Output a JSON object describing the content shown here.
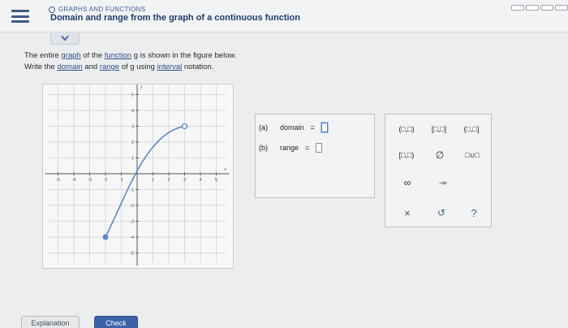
{
  "header": {
    "breadcrumb": "GRAPHS AND FUNCTIONS",
    "title": "Domain and range from the graph of a continuous function"
  },
  "prompt": {
    "line1_a": "The entire ",
    "line1_graph": "graph",
    "line1_b": " of the ",
    "line1_function": "function",
    "line1_c": " g is shown in the figure below.",
    "line2_a": "Write the ",
    "line2_domain": "domain",
    "line2_b": " and ",
    "line2_range": "range",
    "line2_c": " of g using ",
    "line2_interval": "interval",
    "line2_d": " notation."
  },
  "graph": {
    "y_axis_label": "y",
    "x_axis_label": "x",
    "x_tick_labels": [
      "-5",
      "-4",
      "-3",
      "-2",
      "-1",
      "1",
      "2",
      "3",
      "4",
      "5"
    ],
    "y_tick_labels": [
      "5",
      "4",
      "3",
      "2",
      "1",
      "-1",
      "-2",
      "-3",
      "-4",
      "-5"
    ],
    "curve_start": [
      -2,
      -4
    ],
    "curve_end": [
      3,
      3
    ],
    "start_point": "closed",
    "end_point": "open",
    "curve_color": "#5b86c9"
  },
  "answers": {
    "domain_label_prefix": "(a)",
    "domain_label": "domain",
    "range_label_prefix": "(b)",
    "range_label": "range",
    "equals": "="
  },
  "keypad": {
    "open_open": "(□,□)",
    "closed_closed": "[□,□]",
    "open_closed": "(□,□]",
    "closed_open": "[□,□)",
    "empty_set": "∅",
    "union": "□∪□",
    "infinity": "∞",
    "neg_infinity": "-∞",
    "clear": "×",
    "undo": "↺",
    "help": "?"
  },
  "buttons": {
    "explanation": "Explanation",
    "check": "Check"
  }
}
